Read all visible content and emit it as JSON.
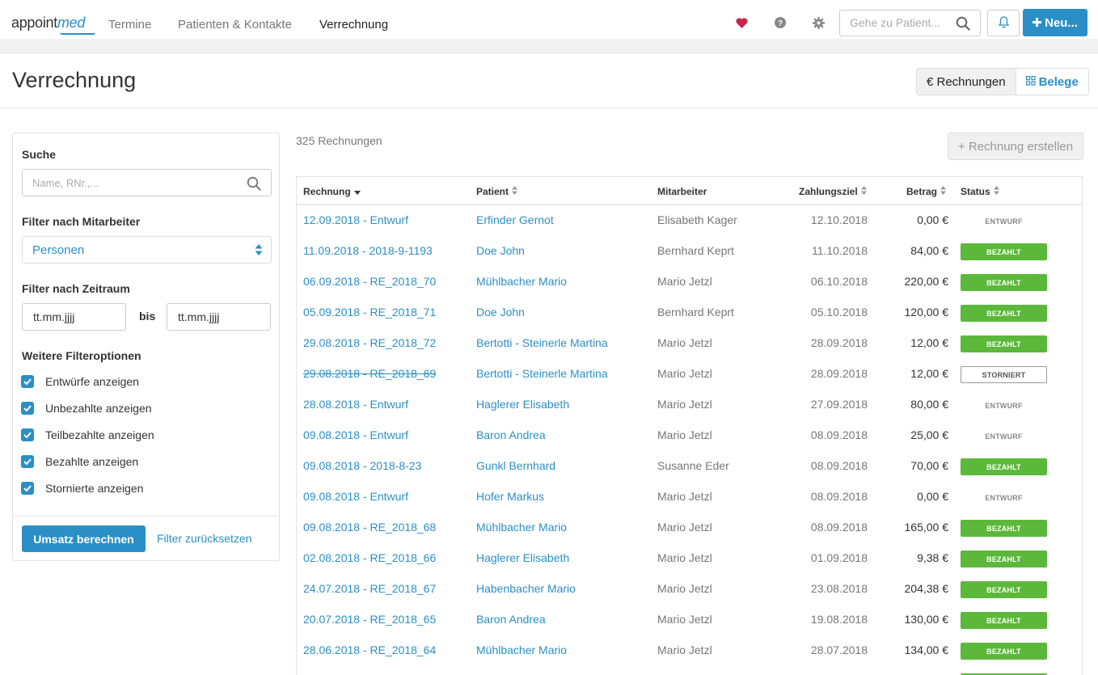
{
  "nav": {
    "logo_main": "appoint",
    "logo_accent": "med",
    "links": [
      "Termine",
      "Patienten & Kontakte",
      "Verrechnung"
    ],
    "search_placeholder": "Gehe zu Patient...",
    "new_label": "Neu...",
    "icons": [
      "heart-icon",
      "help-icon",
      "gear-icon",
      "search-icon",
      "bell-icon",
      "plus-icon"
    ],
    "heart_color": "#c8254e",
    "accent_color": "#2b8fc7"
  },
  "header": {
    "title": "Verrechnung",
    "tab_rechnungen": "€ Rechnungen",
    "tab_belege": "Belege"
  },
  "sidebar": {
    "search_label": "Suche",
    "search_placeholder": "Name, RNr.,...",
    "employee_label": "Filter nach Mitarbeiter",
    "employee_value": "Personen",
    "period_label": "Filter nach Zeitraum",
    "date_from": "tt.mm.jjjj",
    "date_to": "tt.mm.jjjj",
    "bis": "bis",
    "more_label": "Weitere Filteroptionen",
    "checkboxes": [
      {
        "label": "Entwürfe anzeigen",
        "checked": true
      },
      {
        "label": "Unbezahlte anzeigen",
        "checked": true
      },
      {
        "label": "Teilbezahlte anzeigen",
        "checked": true
      },
      {
        "label": "Bezahlte anzeigen",
        "checked": true
      },
      {
        "label": "Stornierte anzeigen",
        "checked": true
      }
    ],
    "compute_label": "Umsatz berechnen",
    "reset_label": "Filter zurücksetzen"
  },
  "main": {
    "count": "325 Rechnungen",
    "create_label": "+ Rechnung erstellen",
    "columns": {
      "invoice": "Rechnung",
      "patient": "Patient",
      "employee": "Mitarbeiter",
      "due": "Zahlungsziel",
      "amount": "Betrag",
      "status": "Status"
    },
    "rows": [
      {
        "invoice": "12.09.2018 - Entwurf",
        "patient": "Erfinder Gernot",
        "employee": "Elisabeth Kager",
        "due": "12.10.2018",
        "amount": "0,00 €",
        "status": "ENTWURF",
        "kind": "draft"
      },
      {
        "invoice": "11.09.2018 - 2018-9-1193",
        "patient": "Doe John",
        "employee": "Bernhard Keprt",
        "due": "11.10.2018",
        "amount": "84,00 €",
        "status": "BEZAHLT",
        "kind": "paid"
      },
      {
        "invoice": "06.09.2018 - RE_2018_70",
        "patient": "Mühlbacher Mario",
        "employee": "Mario Jetzl",
        "due": "06.10.2018",
        "amount": "220,00 €",
        "status": "BEZAHLT",
        "kind": "paid"
      },
      {
        "invoice": "05.09.2018 - RE_2018_71",
        "patient": "Doe John",
        "employee": "Bernhard Keprt",
        "due": "05.10.2018",
        "amount": "120,00 €",
        "status": "BEZAHLT",
        "kind": "paid"
      },
      {
        "invoice": "29.08.2018 - RE_2018_72",
        "patient": "Bertotti - Steinerle Martina",
        "employee": "Mario Jetzl",
        "due": "28.09.2018",
        "amount": "12,00 €",
        "status": "BEZAHLT",
        "kind": "paid"
      },
      {
        "invoice": "29.08.2018 - RE_2018_69",
        "patient": "Bertotti - Steinerle Martina",
        "employee": "Mario Jetzl",
        "due": "28.09.2018",
        "amount": "12,00 €",
        "status": "STORNIERT",
        "kind": "cancel"
      },
      {
        "invoice": "28.08.2018 - Entwurf",
        "patient": "Haglerer Elisabeth",
        "employee": "Mario Jetzl",
        "due": "27.09.2018",
        "amount": "80,00 €",
        "status": "ENTWURF",
        "kind": "draft"
      },
      {
        "invoice": "09.08.2018 - Entwurf",
        "patient": "Baron Andrea",
        "employee": "Mario Jetzl",
        "due": "08.09.2018",
        "amount": "25,00 €",
        "status": "ENTWURF",
        "kind": "draft"
      },
      {
        "invoice": "09.08.2018 - 2018-8-23",
        "patient": "Gunkl Bernhard",
        "employee": "Susanne Eder",
        "due": "08.09.2018",
        "amount": "70,00 €",
        "status": "BEZAHLT",
        "kind": "paid"
      },
      {
        "invoice": "09.08.2018 - Entwurf",
        "patient": "Hofer Markus",
        "employee": "Mario Jetzl",
        "due": "08.09.2018",
        "amount": "0,00 €",
        "status": "ENTWURF",
        "kind": "draft"
      },
      {
        "invoice": "09.08.2018 - RE_2018_68",
        "patient": "Mühlbacher Mario",
        "employee": "Mario Jetzl",
        "due": "08.09.2018",
        "amount": "165,00 €",
        "status": "BEZAHLT",
        "kind": "paid"
      },
      {
        "invoice": "02.08.2018 - RE_2018_66",
        "patient": "Haglerer Elisabeth",
        "employee": "Mario Jetzl",
        "due": "01.09.2018",
        "amount": "9,38 €",
        "status": "BEZAHLT",
        "kind": "paid"
      },
      {
        "invoice": "24.07.2018 - RE_2018_67",
        "patient": "Habenbacher Mario",
        "employee": "Mario Jetzl",
        "due": "23.08.2018",
        "amount": "204,38 €",
        "status": "BEZAHLT",
        "kind": "paid"
      },
      {
        "invoice": "20.07.2018 - RE_2018_65",
        "patient": "Baron Andrea",
        "employee": "Mario Jetzl",
        "due": "19.08.2018",
        "amount": "130,00 €",
        "status": "BEZAHLT",
        "kind": "paid"
      },
      {
        "invoice": "28.06.2018 - RE_2018_64",
        "patient": "Mühlbacher Mario",
        "employee": "Mario Jetzl",
        "due": "28.07.2018",
        "amount": "134,00 €",
        "status": "BEZAHLT",
        "kind": "paid"
      }
    ]
  }
}
